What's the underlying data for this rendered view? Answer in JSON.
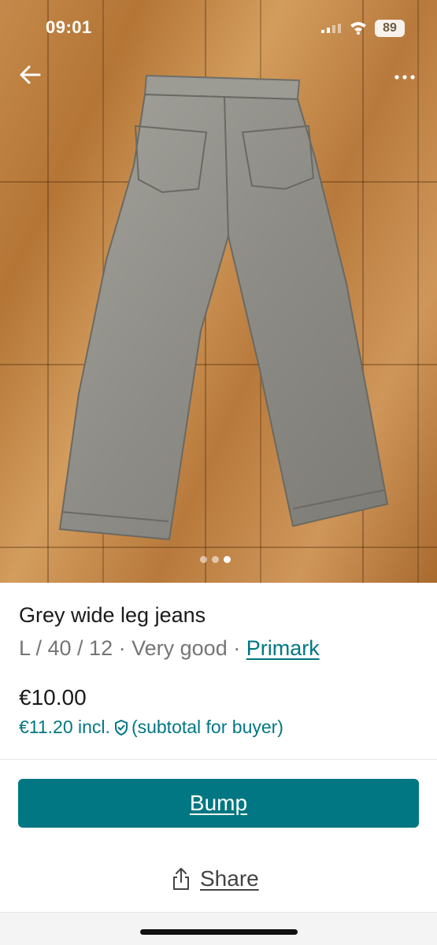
{
  "status_bar": {
    "time": "09:01",
    "battery": "89"
  },
  "photo": {
    "page_count": 3,
    "active_page": 3
  },
  "listing": {
    "title": "Grey wide leg jeans",
    "size": "L / 40 / 12",
    "separator": "·",
    "condition": "Very good",
    "brand": "Primark",
    "price": "€10.00",
    "price_incl": "€11.20 incl.",
    "price_incl_note": "(subtotal for buyer)"
  },
  "actions": {
    "bump_label": "Bump",
    "share_label": "Share"
  },
  "colors": {
    "accent": "#007782",
    "text": "#1a1a1a",
    "muted": "#757575"
  },
  "icons": [
    "back-arrow-icon",
    "more-options-icon",
    "shield-icon",
    "share-icon",
    "wifi-icon",
    "signal-icon",
    "battery-icon"
  ]
}
